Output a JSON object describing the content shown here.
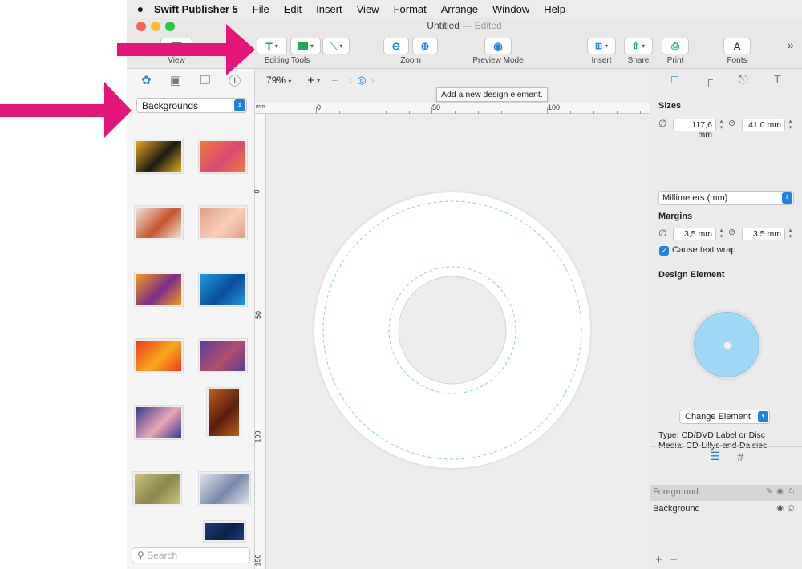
{
  "menu_bar": {
    "app_name": "Swift Publisher 5",
    "items": [
      "File",
      "Edit",
      "Insert",
      "View",
      "Format",
      "Arrange",
      "Window",
      "Help"
    ]
  },
  "window": {
    "title": "Untitled",
    "title_sep": " — ",
    "title_status": "Edited"
  },
  "toolbar": {
    "view_label": "View",
    "editing_tools_label": "Editing Tools",
    "zoom_label": "Zoom",
    "preview_mode_label": "Preview Mode",
    "insert_label": "Insert",
    "share_label": "Share",
    "print_label": "Print",
    "fonts_label": "Fonts",
    "fonts_glyph": "A",
    "overflow_glyph": "»"
  },
  "sidebar": {
    "category_select": "Backgrounds",
    "search_placeholder": "Search",
    "thumbnails": [
      {
        "colors": [
          "#e2a91c",
          "#1d1a14"
        ]
      },
      {
        "colors": [
          "#f07b3a",
          "#d94a73"
        ]
      },
      {
        "colors": [
          "#efe3d6",
          "#c6552c"
        ]
      },
      {
        "colors": [
          "#e39c82",
          "#f7d0b9"
        ]
      },
      {
        "colors": [
          "#f59b1a",
          "#7a2d8c"
        ]
      },
      {
        "colors": [
          "#1f9be2",
          "#0a4c9a"
        ]
      },
      {
        "colors": [
          "#ee3b1b",
          "#f7a91d"
        ]
      },
      {
        "colors": [
          "#5b3fa0",
          "#b04f6c"
        ]
      },
      {
        "colors": [
          "#3e3a8e",
          "#e9a7b8"
        ]
      },
      {
        "colors": [
          "#b9631b",
          "#5b1d0d"
        ]
      },
      {
        "colors": [
          "#c9c27a",
          "#8b8650"
        ]
      },
      {
        "colors": [
          "#dde3ec",
          "#7a88a8"
        ]
      },
      {
        "colors": [
          "#1b3e7c",
          "#0d2048"
        ]
      }
    ]
  },
  "canvas": {
    "zoom": "79%",
    "tooltip": "Add a new design element.",
    "ruler_unit": "mm",
    "ruler_top": [
      "0",
      "50",
      "100"
    ],
    "ruler_left": [
      "0",
      "50",
      "100",
      "150"
    ]
  },
  "inspector": {
    "sizes_title": "Sizes",
    "width_value": "117,6 mm",
    "height_value": "41,0 mm",
    "units_select": "Millimeters (mm)",
    "margins_title": "Margins",
    "margin_outer": "3,5 mm",
    "margin_inner": "3,5 mm",
    "cause_text_wrap_label": "Cause text wrap",
    "cause_text_wrap_checked": true,
    "design_element_title": "Design Element",
    "change_element_label": "Change Element",
    "type_text": "Type: CD/DVD Label or Disc",
    "media_text": "Media: CD-Lillys-and-Daisies",
    "layers": [
      {
        "name": "Foreground",
        "selected": true
      },
      {
        "name": "Background",
        "selected": false
      }
    ],
    "add_glyph": "+",
    "remove_glyph": "−"
  },
  "colors": {
    "accent": "#1f82e0",
    "annotation_arrow": "#e6157a",
    "dashed_guide": "#8fd2e4"
  }
}
